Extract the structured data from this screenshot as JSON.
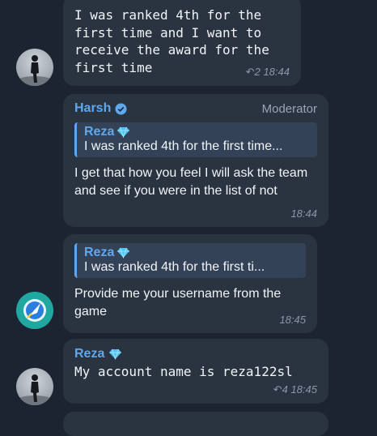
{
  "messages": [
    {
      "id": "m1",
      "text": "I was ranked 4th for the\nfirst time and I want to\nreceive the award for the\nfirst time",
      "reply_count": "2",
      "time": "18:44"
    },
    {
      "id": "m2",
      "sender": "Harsh",
      "role": "Moderator",
      "quote_name": "Reza",
      "quote_text": "I was ranked 4th for the first time...",
      "text": "I get that how you feel I will ask the team and see if you were in the list of not",
      "time": "18:44"
    },
    {
      "id": "m3",
      "quote_name": "Reza",
      "quote_text": "I was ranked 4th for the first ti...",
      "text": "Provide me your username from the game",
      "time": "18:45"
    },
    {
      "id": "m4",
      "sender": "Reza",
      "text": "My account name is reza122sl",
      "reply_count": "4",
      "time": "18:45"
    }
  ],
  "icons": {
    "verified": "verified-badge-icon",
    "diamond": "diamond-icon",
    "reply": "reply-arrow-icon"
  },
  "colors": {
    "background": "#1c2431",
    "bubble": "#2a3340",
    "accent": "#5fa8ee",
    "meta": "#8b98a8"
  }
}
